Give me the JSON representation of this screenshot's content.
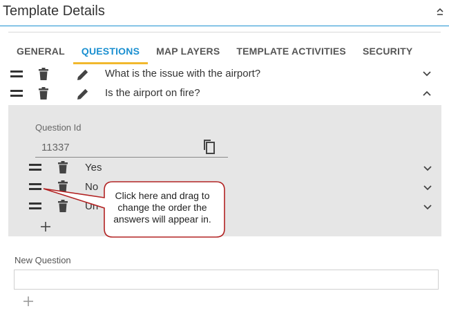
{
  "header": {
    "title": "Template Details"
  },
  "tabs": [
    {
      "label": "GENERAL",
      "active": false
    },
    {
      "label": "QUESTIONS",
      "active": true
    },
    {
      "label": "MAP LAYERS",
      "active": false
    },
    {
      "label": "TEMPLATE ACTIVITIES",
      "active": false
    },
    {
      "label": "SECURITY",
      "active": false
    }
  ],
  "questions": [
    {
      "text": "What is the issue with the airport?",
      "expanded": false
    },
    {
      "text": "Is the airport on fire?",
      "expanded": true
    }
  ],
  "panel": {
    "question_id_label": "Question Id",
    "question_id_value": "11337",
    "answers": [
      {
        "text": "Yes"
      },
      {
        "text": "No"
      },
      {
        "text": "Un"
      }
    ]
  },
  "new_question": {
    "label": "New Question",
    "value": ""
  },
  "callout": {
    "text": "Click here and drag to change the order the answers will appear in."
  },
  "colors": {
    "accent": "#1a8fd0",
    "tab_underline": "#f1b82d",
    "callout_border": "#b22222",
    "panel_bg": "#e6e6e6"
  }
}
